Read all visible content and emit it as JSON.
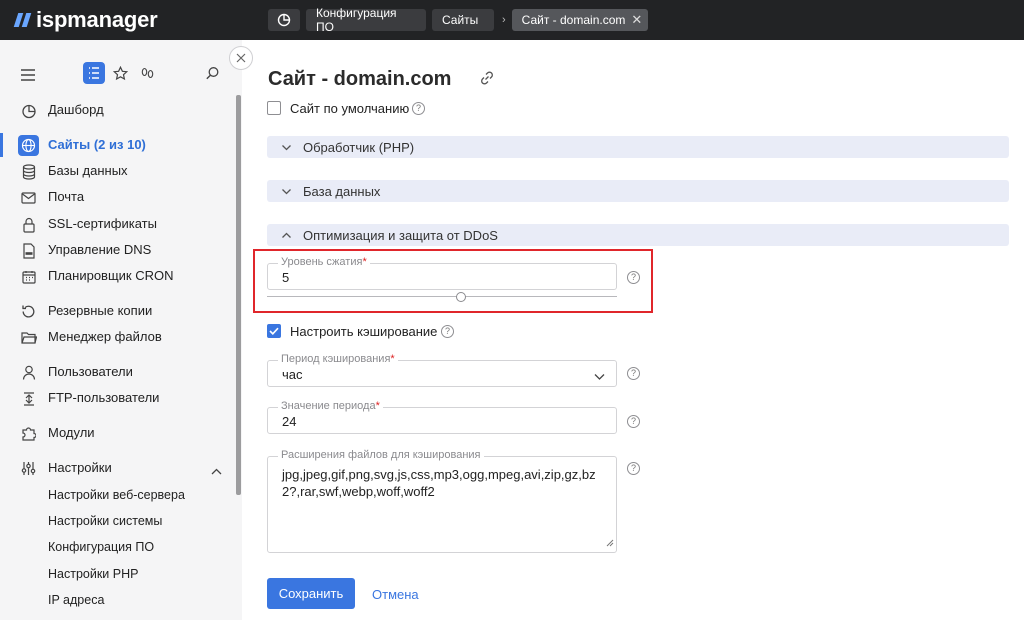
{
  "app": {
    "brand": "ispmanager"
  },
  "breadcrumbs": {
    "items": [
      {
        "label": "Конфигурация ПО"
      },
      {
        "label": "Сайты"
      },
      {
        "label": "Сайт - domain.com"
      }
    ]
  },
  "sidebar": {
    "items": [
      {
        "label": "Дашборд",
        "icon": "dashboard-icon"
      },
      {
        "label": "Сайты (2 из 10)",
        "icon": "globe-icon",
        "active": true
      },
      {
        "label": "Базы данных",
        "icon": "database-icon"
      },
      {
        "label": "Почта",
        "icon": "mail-icon"
      },
      {
        "label": "SSL-сертификаты",
        "icon": "certificate-icon"
      },
      {
        "label": "Управление DNS",
        "icon": "dns-icon"
      },
      {
        "label": "Планировщик CRON",
        "icon": "calendar-icon"
      },
      {
        "label": "Резервные копии",
        "icon": "backup-icon"
      },
      {
        "label": "Менеджер файлов",
        "icon": "folder-icon"
      },
      {
        "label": "Пользователи",
        "icon": "user-icon"
      },
      {
        "label": "FTP-пользователи",
        "icon": "ftp-icon"
      },
      {
        "label": "Модули",
        "icon": "puzzle-icon"
      },
      {
        "label": "Настройки",
        "icon": "settings-icon"
      }
    ],
    "subitems": [
      {
        "label": "Настройки веб-сервера"
      },
      {
        "label": "Настройки системы"
      },
      {
        "label": "Конфигурация ПО"
      },
      {
        "label": "Настройки PHP"
      },
      {
        "label": "IP адреса"
      }
    ]
  },
  "page": {
    "title": "Сайт - domain.com",
    "default_site_label": "Сайт по умолчанию",
    "sections": [
      {
        "title": "Обработчик (PHP)"
      },
      {
        "title": "База данных"
      },
      {
        "title": "Оптимизация и защита от DDoS"
      }
    ],
    "compression": {
      "label": "Уровень сжатия",
      "required": "*",
      "value": "5",
      "level": 5,
      "max": 9
    },
    "caching_label": "Настроить кэширование",
    "cache_period": {
      "label": "Период кэширования",
      "required": "*",
      "value": "час"
    },
    "period_value": {
      "label": "Значение периода",
      "required": "*",
      "value": "24"
    },
    "extensions": {
      "label": "Расширения файлов для кэширования",
      "value": "jpg,jpeg,gif,png,svg,js,css,mp3,ogg,mpeg,avi,zip,gz,bz2?,rar,swf,webp,woff,woff2"
    },
    "help_glyph": "?",
    "save_label": "Сохранить",
    "cancel_label": "Отмена"
  },
  "colors": {
    "accent": "#3a76e0",
    "topbar": "#222325",
    "highlight": "#e0262b",
    "sidebar_bg": "#f5f5f6",
    "section_bg": "#e9ecf7"
  }
}
